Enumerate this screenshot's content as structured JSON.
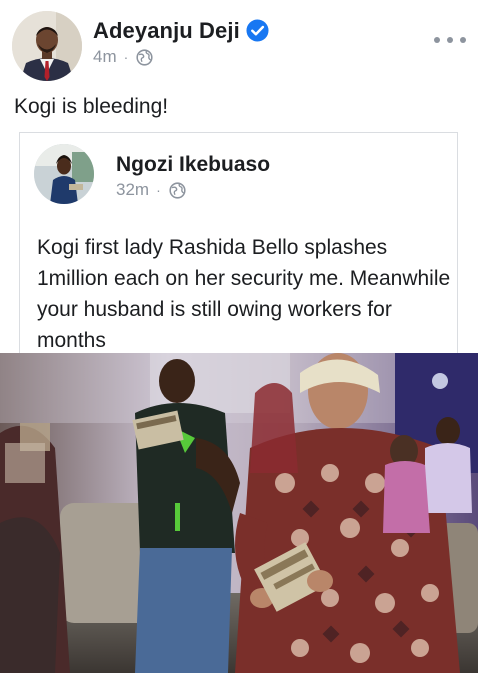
{
  "post": {
    "author_name": "Adeyanju Deji",
    "verified": true,
    "timestamp": "4m",
    "separator": "·",
    "privacy_icon": "globe-icon",
    "menu_icon": "more-options-icon",
    "text": "Kogi is bleeding!"
  },
  "shared_post": {
    "author_name": "Ngozi Ikebuaso",
    "timestamp": "32m",
    "separator": "·",
    "privacy_icon": "globe-icon",
    "text": "Kogi first lady Rashida Bello splashes 1million each on her security me. Meanwhile your husband is still owing workers for months"
  },
  "colors": {
    "verified_badge": "#1877f2",
    "meta_gray": "#8d949e",
    "text": "#1c1e21",
    "card_border": "#dadde1"
  }
}
